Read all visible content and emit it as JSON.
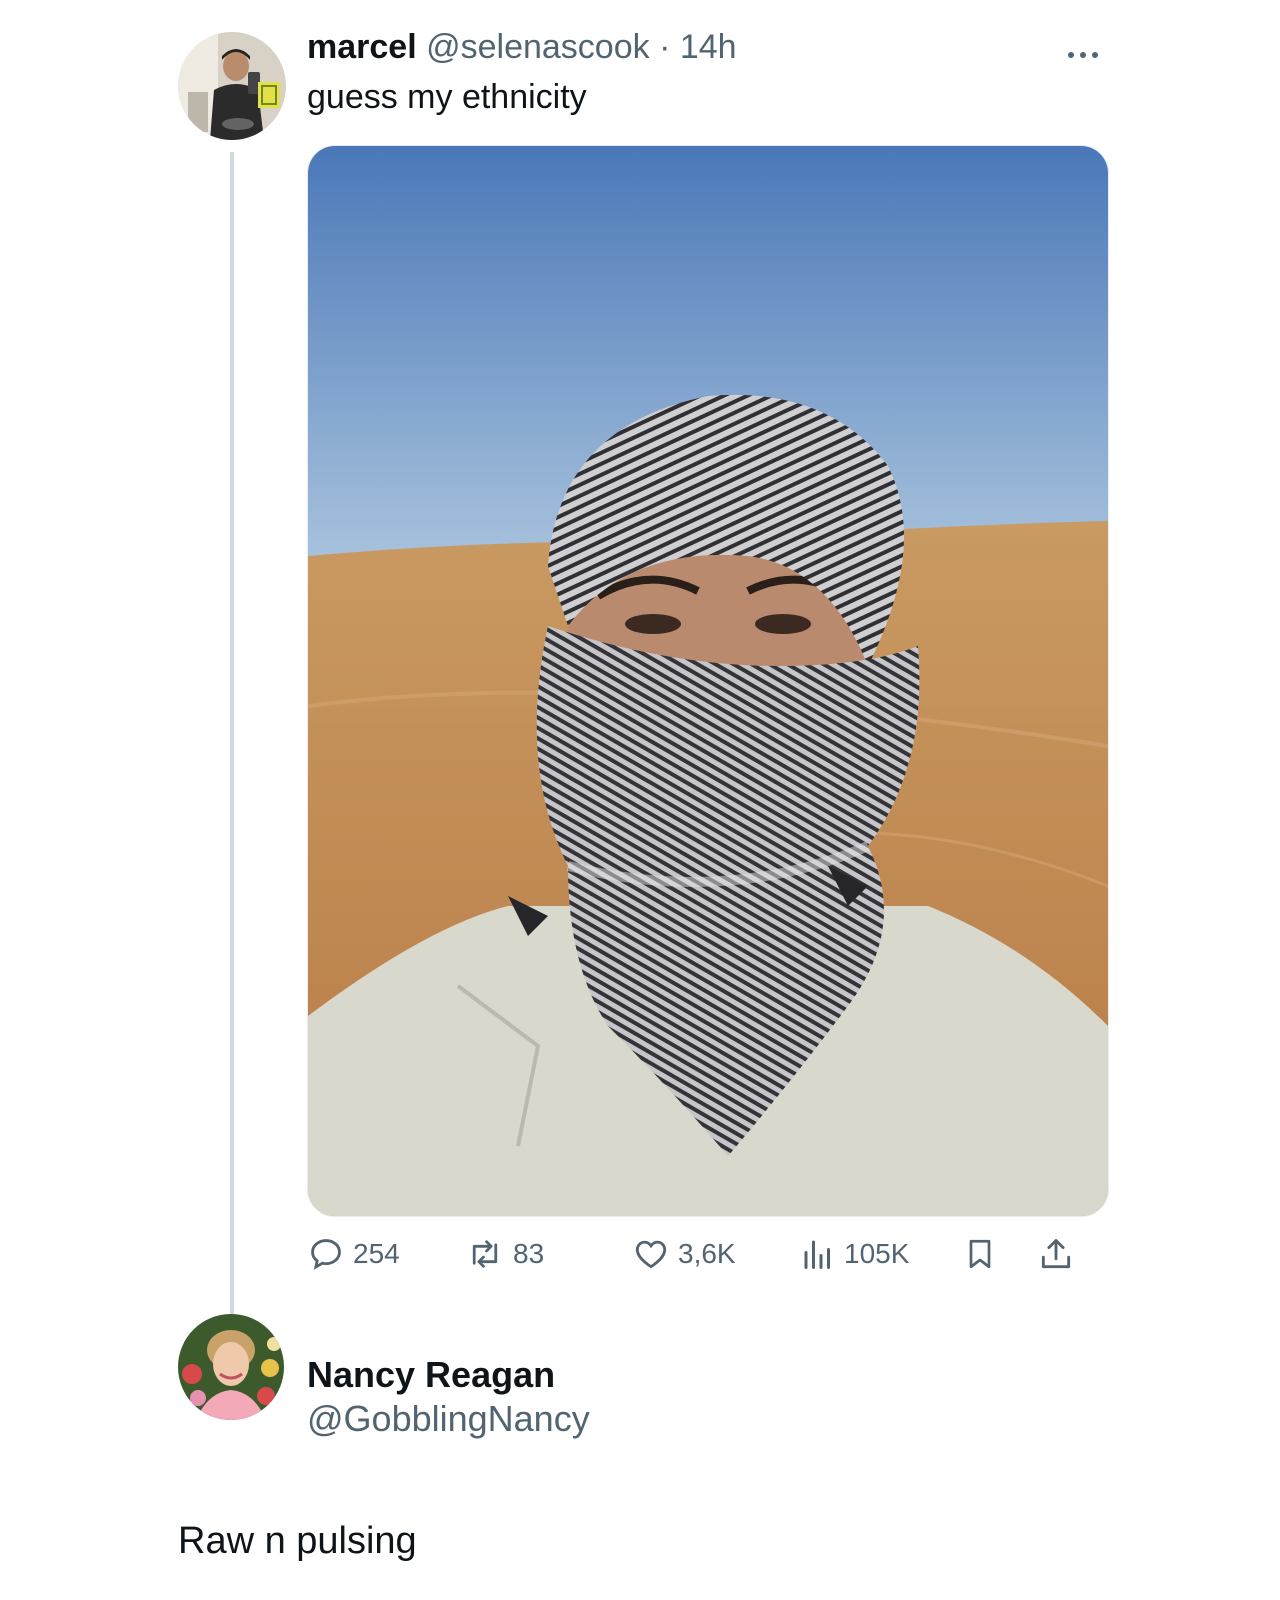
{
  "post": {
    "name": "marcel",
    "handle": "@selenascook",
    "separator": "·",
    "time": "14h",
    "text": "guess my ethnicity",
    "more_icon": "more-dots-icon",
    "media_icon": "desert-selfie-photo",
    "actions": {
      "replies": "254",
      "reposts": "83",
      "likes": "3,6K",
      "views": "105K"
    },
    "action_icons": [
      "reply-icon",
      "repost-icon",
      "like-icon",
      "views-icon",
      "bookmark-icon",
      "share-icon"
    ]
  },
  "reply_account": {
    "name": "Nancy Reagan",
    "handle": "@GobblingNancy"
  },
  "caption": "Raw n pulsing",
  "colors": {
    "text": "#0f1419",
    "muted": "#536471",
    "thread_line": "#cfd9de"
  }
}
